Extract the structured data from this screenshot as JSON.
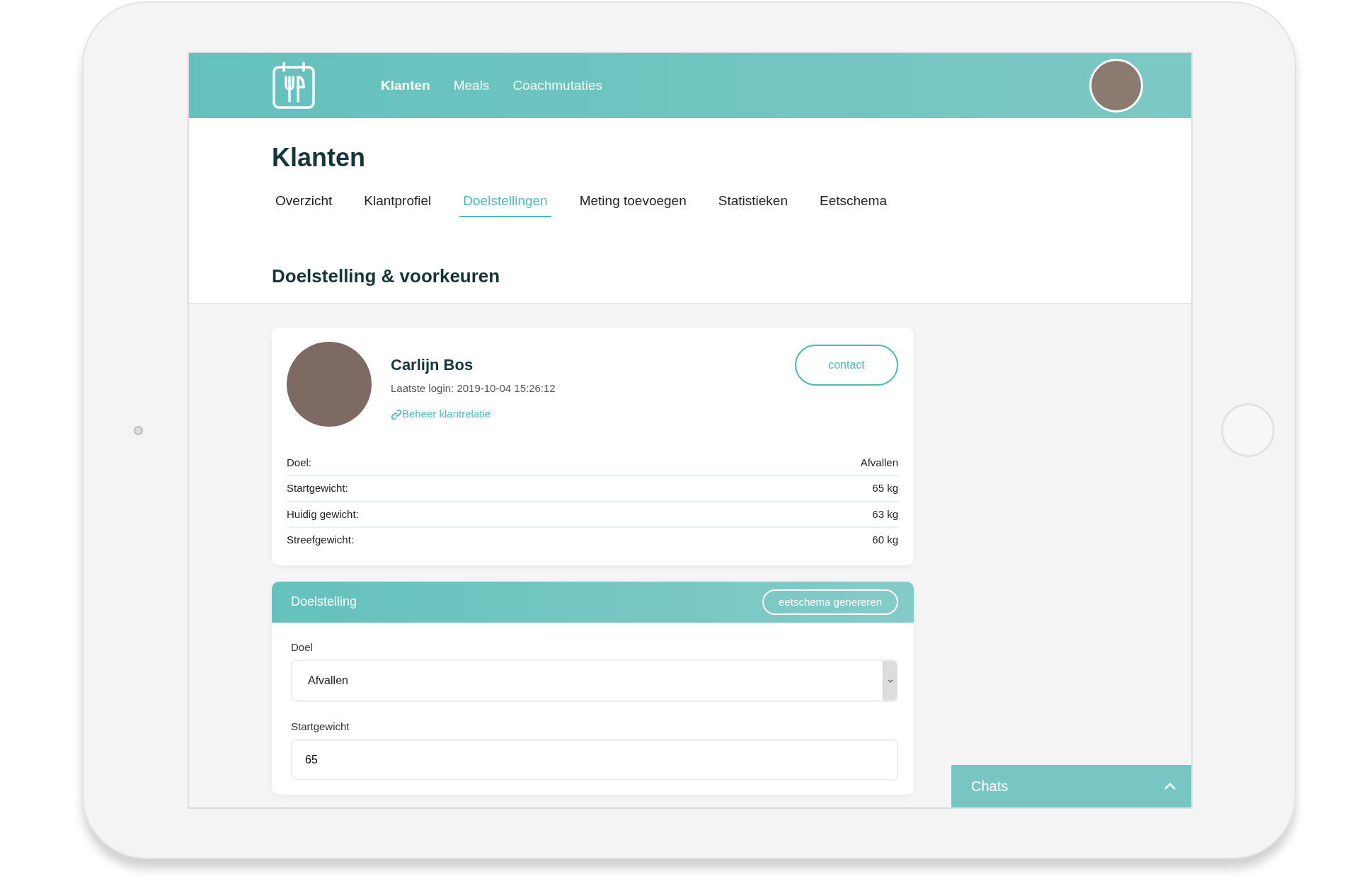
{
  "nav": {
    "items": [
      {
        "label": "Klanten",
        "selected": true
      },
      {
        "label": "Meals",
        "selected": false
      },
      {
        "label": "Coachmutaties",
        "selected": false
      }
    ]
  },
  "page_title": "Klanten",
  "tabs": [
    {
      "label": "Overzicht",
      "selected": false
    },
    {
      "label": "Klantprofiel",
      "selected": false
    },
    {
      "label": "Doelstellingen",
      "selected": true
    },
    {
      "label": "Meting toevoegen",
      "selected": false
    },
    {
      "label": "Statistieken",
      "selected": false
    },
    {
      "label": "Eetschema",
      "selected": false
    }
  ],
  "section_title": "Doelstelling & voorkeuren",
  "client": {
    "name": "Carlijn Bos",
    "last_login": "Laatste login: 2019-10-04 15:26:12",
    "manage_link": "Beheer klantrelatie",
    "contact_button": "contact",
    "details": [
      {
        "label": "Doel:",
        "value": "Afvallen"
      },
      {
        "label": "Startgewicht:",
        "value": "65 kg"
      },
      {
        "label": "Huidig gewicht:",
        "value": "63 kg"
      },
      {
        "label": "Streefgewicht:",
        "value": "60 kg"
      }
    ]
  },
  "goal_form": {
    "title": "Doelstelling",
    "button": "eetschema genereren",
    "fields": [
      {
        "kind": "select",
        "label": "Doel",
        "value": "Afvallen"
      },
      {
        "kind": "input",
        "label": "Startgewicht",
        "value": "65"
      }
    ]
  },
  "chat_panel": {
    "title": "Chats"
  }
}
